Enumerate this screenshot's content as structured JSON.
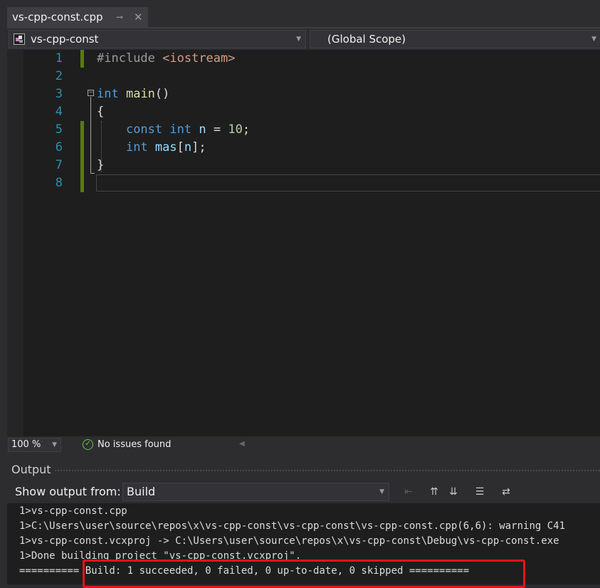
{
  "tab": {
    "title": "vs-cpp-const.cpp",
    "pin_icon": "pin-icon",
    "close_icon": "close-icon",
    "close_glyph": "✕",
    "pin_glyph": "⊸"
  },
  "navbar": {
    "project": "vs-cpp-const",
    "scope": "(Global Scope)"
  },
  "editor": {
    "line_numbers": [
      "1",
      "2",
      "3",
      "4",
      "5",
      "6",
      "7",
      "8"
    ],
    "lines": {
      "l1_pp": "#include",
      "l1_inc": "<iostream>",
      "l3_kw": "int",
      "l3_fn": "main",
      "l3_rest": "()",
      "l4": "{",
      "l5_kw1": "const",
      "l5_kw2": "int",
      "l5_var": "n",
      "l5_eq": " = ",
      "l5_num": "10",
      "l5_end": ";",
      "l6_kw": "int",
      "l6_var1": "mas",
      "l6_br1": "[",
      "l6_var2": "n",
      "l6_br2": "];",
      "l7": "}"
    }
  },
  "status": {
    "zoom": "100 %",
    "issues": "No issues found"
  },
  "output": {
    "title": "Output",
    "show_from_label": "Show output from:",
    "source": "Build",
    "lines": [
      "1>vs-cpp-const.cpp",
      "1>C:\\Users\\user\\source\\repos\\x\\vs-cpp-const\\vs-cpp-const\\vs-cpp-const.cpp(6,6): warning C41",
      "1>vs-cpp-const.vcxproj -> C:\\Users\\user\\source\\repos\\x\\vs-cpp-const\\Debug\\vs-cpp-const.exe",
      "1>Done building project \"vs-cpp-const.vcxproj\".",
      "========== Build: 1 succeeded, 0 failed, 0 up-to-date, 0 skipped =========="
    ]
  },
  "colors": {
    "accent_change": "#587c0c",
    "highlight_box": "#e8131b",
    "ok_green": "#6cc65a"
  }
}
